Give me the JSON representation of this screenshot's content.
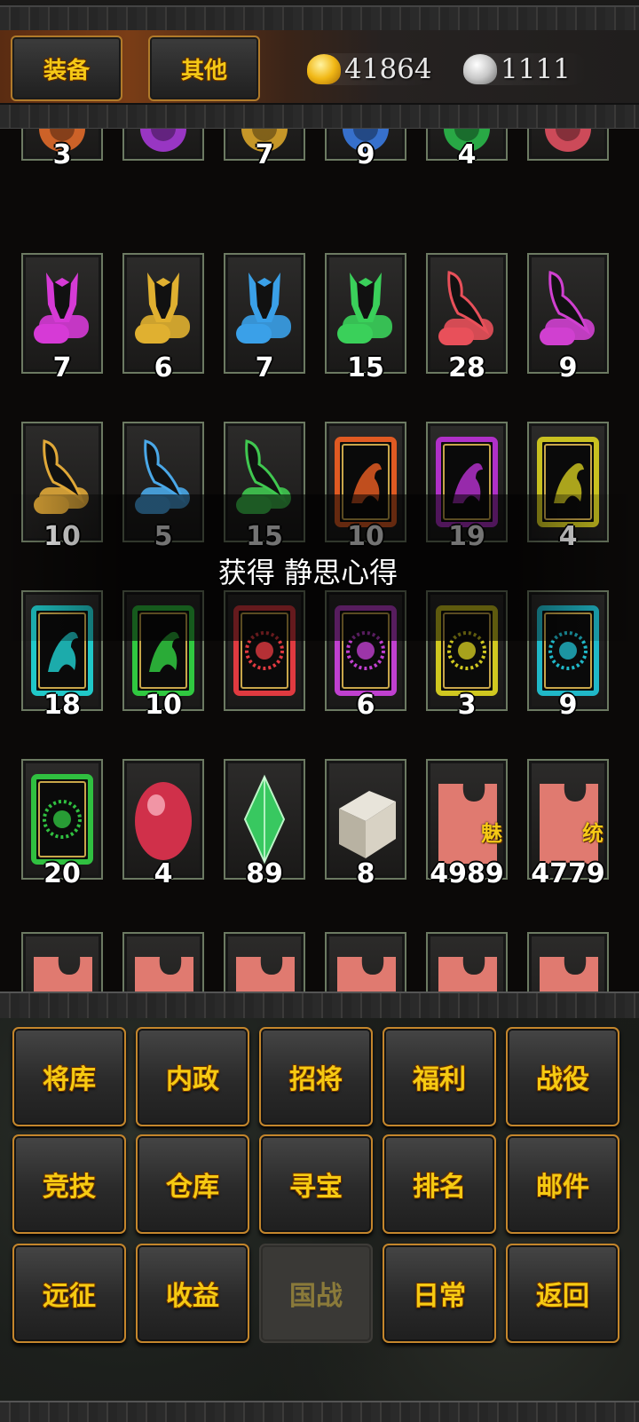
{
  "header": {
    "tabs": [
      {
        "label": "装备"
      },
      {
        "label": "其他"
      }
    ],
    "gold": {
      "icon": "gold-ingot-icon",
      "value": "41864"
    },
    "silver": {
      "icon": "silver-ingot-icon",
      "value": "1111"
    }
  },
  "inventory": {
    "rows": [
      [
        {
          "icon": "orange-orb-icon",
          "color": "#e06a2a",
          "count": "3"
        },
        {
          "icon": "purple-orb-icon",
          "color": "#a63ad6",
          "count": ""
        },
        {
          "icon": "gold-orb-icon",
          "color": "#d8a42a",
          "count": "7"
        },
        {
          "icon": "blue-orb-icon",
          "color": "#3a7ae0",
          "count": "9"
        },
        {
          "icon": "green-orb-icon",
          "color": "#2ab84a",
          "count": "4"
        },
        {
          "icon": "red-orb-icon",
          "color": "#e05060",
          "count": ""
        }
      ],
      [
        {
          "icon": "magenta-armor-scroll-icon",
          "color": "#d63ad6",
          "count": "7"
        },
        {
          "icon": "gold-armor-scroll-icon",
          "color": "#e0b030",
          "count": "6"
        },
        {
          "icon": "blue-armor-scroll-icon",
          "color": "#3aa0e8",
          "count": "7"
        },
        {
          "icon": "green-armor-scroll-icon",
          "color": "#3ad05a",
          "count": "15"
        },
        {
          "icon": "red-weapon-scroll-icon",
          "color": "#e8505a",
          "count": "28"
        },
        {
          "icon": "magenta-weapon-scroll-icon",
          "color": "#d040d0",
          "count": "9"
        }
      ],
      [
        {
          "icon": "gold-weapon-scroll-icon",
          "color": "#e0a838",
          "count": "10"
        },
        {
          "icon": "blue-weapon-scroll-icon",
          "color": "#4aa8e8",
          "count": "5"
        },
        {
          "icon": "green-weapon-scroll-icon",
          "color": "#40c850",
          "count": "15"
        },
        {
          "icon": "orange-horse-card-icon",
          "color": "#e05a22",
          "count": "10"
        },
        {
          "icon": "purple-horse-card-icon",
          "color": "#b030c8",
          "count": "19"
        },
        {
          "icon": "yellow-horse-card-icon",
          "color": "#c8c020",
          "count": "4"
        }
      ],
      [
        {
          "icon": "cyan-horse-card-icon",
          "color": "#20c8c8",
          "count": "18"
        },
        {
          "icon": "green-horse-card-icon",
          "color": "#30c840",
          "count": "10"
        },
        {
          "icon": "red-seal-card-icon",
          "color": "#e03a40",
          "count": ""
        },
        {
          "icon": "purple-seal-card-icon",
          "color": "#c040d0",
          "count": "6"
        },
        {
          "icon": "yellow-seal-card-icon",
          "color": "#d0c820",
          "count": "3"
        },
        {
          "icon": "cyan-seal-card-icon",
          "color": "#20b8c8",
          "count": "9"
        }
      ],
      [
        {
          "icon": "green-seal-card-icon",
          "color": "#30c040",
          "count": "20"
        },
        {
          "icon": "red-gem-icon",
          "color": "#d0304a",
          "count": "4"
        },
        {
          "icon": "green-gem-icon",
          "color": "#38c860",
          "count": "89"
        },
        {
          "icon": "book-icon",
          "color": "#c8c4b8",
          "count": "8"
        },
        {
          "icon": "charm-fragment-icon",
          "color": "#e07a70",
          "count": "4989",
          "tag": "魅"
        },
        {
          "icon": "command-fragment-icon",
          "color": "#e07a70",
          "count": "4779",
          "tag": "统"
        }
      ],
      [
        {
          "icon": "fragment-icon",
          "color": "#e07a70",
          "count": ""
        },
        {
          "icon": "fragment-icon",
          "color": "#e07a70",
          "count": ""
        },
        {
          "icon": "fragment-icon",
          "color": "#e07a70",
          "count": ""
        },
        {
          "icon": "fragment-icon",
          "color": "#e07a70",
          "count": ""
        },
        {
          "icon": "fragment-icon",
          "color": "#e07a70",
          "count": ""
        },
        {
          "icon": "fragment-icon",
          "color": "#e07a70",
          "count": ""
        }
      ]
    ]
  },
  "toast": {
    "text": "获得 静思心得"
  },
  "menu": [
    {
      "label": "将库"
    },
    {
      "label": "内政"
    },
    {
      "label": "招将"
    },
    {
      "label": "福利"
    },
    {
      "label": "战役"
    },
    {
      "label": "竞技"
    },
    {
      "label": "仓库"
    },
    {
      "label": "寻宝"
    },
    {
      "label": "排名"
    },
    {
      "label": "邮件"
    },
    {
      "label": "远征"
    },
    {
      "label": "收益"
    },
    {
      "label": "国战",
      "disabled": true
    },
    {
      "label": "日常"
    },
    {
      "label": "返回"
    }
  ]
}
